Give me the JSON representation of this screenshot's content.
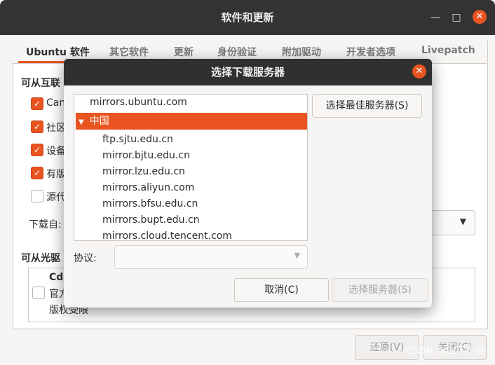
{
  "window": {
    "title": "软件和更新"
  },
  "tabs": [
    "Ubuntu 软件",
    "其它软件",
    "更新",
    "身份验证",
    "附加驱动",
    "开发者选项",
    "Livepatch"
  ],
  "main": {
    "section_internet": "可从互联",
    "checkboxes": [
      {
        "label": "Cano",
        "checked": true
      },
      {
        "label": "社区",
        "checked": true
      },
      {
        "label": "设备",
        "checked": true
      },
      {
        "label": "有版",
        "checked": true
      },
      {
        "label": "源代",
        "checked": false
      }
    ],
    "download_from_label": "下载自:",
    "section_cdrom": "可从光驱",
    "cd_title": "Cdr",
    "cd_line1": "官方",
    "cd_line2": "版权受限",
    "revert_button": "还原(V)",
    "close_button": "关闭(C)"
  },
  "dialog": {
    "title": "选择下载服务器",
    "servers": {
      "top": "mirrors.ubuntu.com",
      "group": "中国",
      "children": [
        "ftp.sjtu.edu.cn",
        "mirror.bjtu.edu.cn",
        "mirror.lzu.edu.cn",
        "mirrors.aliyun.com",
        "mirrors.bfsu.edu.cn",
        "mirrors.bupt.edu.cn",
        "mirrors.cloud.tencent.com"
      ]
    },
    "best_server_button": "选择最佳服务器(S)",
    "protocol_label": "协议:",
    "protocol_value": "",
    "cancel_button": "取消(C)",
    "choose_server_button": "选择服务器(S)"
  },
  "watermark": "CSDN @山下小僧",
  "colors": {
    "accent": "#e95420",
    "titlebar": "#333333"
  }
}
